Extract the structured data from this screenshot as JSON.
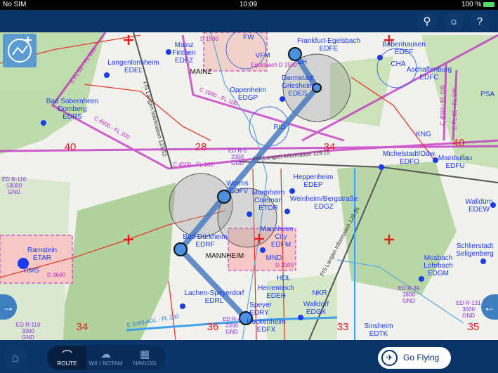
{
  "status": {
    "carrier": "No SIM",
    "time": "10:09",
    "battery": "100 %"
  },
  "toolbar": {
    "icons": [
      "search-icon",
      "brightness-icon",
      "help-icon"
    ],
    "search": "⚲",
    "brightness": "☼",
    "help": "?"
  },
  "bottom": {
    "home_icon": "home-icon",
    "tabs": [
      {
        "label": "ROUTE",
        "icon": "route-icon",
        "active": true
      },
      {
        "label": "WX / NOTAM",
        "icon": "weather-icon",
        "active": false
      },
      {
        "label": "NAVLOG",
        "icon": "grid-icon",
        "active": false
      }
    ],
    "go_flying": "Go Flying"
  },
  "colors": {
    "topbar": "#0a3566",
    "route": "#4a7cc0",
    "airspace": "#c020c0",
    "airport": "#1a3cf0",
    "accent": "#3f7fbf"
  },
  "map": {
    "labels": [
      "Mainz",
      "Finthen",
      "EDFZ",
      "MAINZ",
      "Langenlonsheim",
      "EDEL",
      "Bad Sobernheim",
      "Domberg",
      "EDRS",
      "Oppenheim",
      "EDGP",
      "Frankfurt-Egelsbach",
      "EDFE",
      "VFM",
      "Egelsbach D 1500",
      "EH",
      "Darmstadt",
      "Griesheim",
      "EDES",
      "RID",
      "Babenhausen",
      "EDEF",
      "CHA",
      "Aschaffenburg",
      "EDFC",
      "PSA",
      "KNG",
      "Michelstadt/Odw.",
      "EDFO",
      "Mainbullau",
      "EDFU",
      "Worms",
      "EDFV",
      "Mannheim",
      "Coleman",
      "ETOR",
      "Heppenheim",
      "EDEP",
      "Weinheim/Bergstraße",
      "EDGZ",
      "Bad Dürkheim",
      "EDRF",
      "MANNHEIM",
      "Mannheim",
      "City",
      "EDFM",
      "MND",
      "D 2000",
      "Ramstein",
      "ETAR",
      "RMS",
      "D 3600",
      "HDL",
      "Herrenteich",
      "EDEH",
      "Lachen-Speyerdorf",
      "EDRL",
      "NKR",
      "Walldorf",
      "EDGX",
      "Speyer",
      "EDRY",
      "Hockenheim",
      "EDFX",
      "Sinsheim",
      "EDTK",
      "Walldürn",
      "EDEW",
      "Schlierstadt",
      "Seligenberg",
      "Mosbach",
      "Lohrbach",
      "EDGM",
      "FW",
      "D 1500"
    ],
    "airspace_labels": [
      "C FL 65 - FL 100",
      "C 1500 - FL 100",
      "C 4500 - FL 100",
      "C 4500 - FL 100",
      "C 4500 - FL 100",
      "C FL 65 - FL 100",
      "E 1000 AGL - FL 100"
    ],
    "restricted": [
      {
        "name": "ED R-116",
        "upper": "18000",
        "lower": "GND"
      },
      {
        "name": "ED R-5",
        "upper": "2300",
        "lower": "GND"
      },
      {
        "name": "ED R-118",
        "upper": "3300",
        "lower": "GND"
      },
      {
        "name": "ED R-4",
        "upper": "2300",
        "lower": "GND"
      },
      {
        "name": "ED R-39",
        "upper": "2800",
        "lower": "GND"
      },
      {
        "name": "ED R-131",
        "upper": "3000",
        "lower": "GND"
      }
    ],
    "fis": [
      "FIS Langen Information 123.52",
      "FIS Langen Information 119.15",
      "FIS Langen Information 128.95"
    ],
    "grid_numbers": [
      "40",
      "28",
      "34",
      "40",
      "34",
      "36",
      "33",
      "35"
    ],
    "route": [
      "EDFE",
      "EDES",
      "EDFV",
      "EDRF",
      "EDRY"
    ]
  }
}
